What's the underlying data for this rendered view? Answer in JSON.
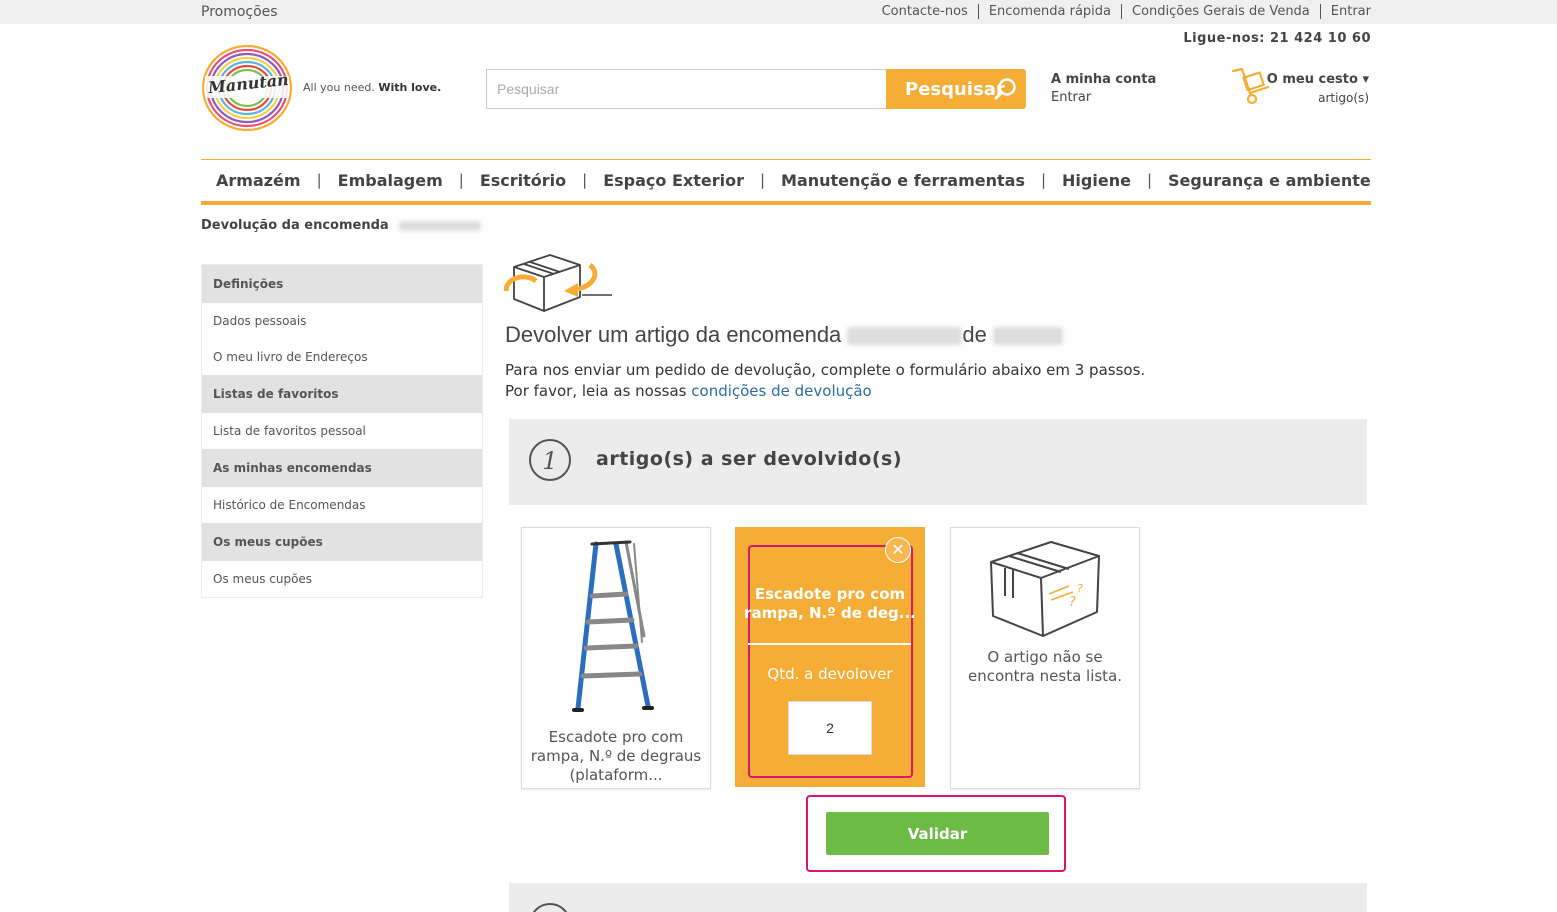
{
  "topbar": {
    "promo": "Promoções",
    "links": [
      "Contacte-nos",
      "Encomenda rápida",
      "Condições Gerais de Venda",
      "Entrar"
    ]
  },
  "phone": "Ligue-nos: 21 424 10 60",
  "brand": {
    "logo_text": "Manutan",
    "tagline_a": "All you need.",
    "tagline_b": "With love."
  },
  "search": {
    "placeholder": "Pesquisar",
    "button": "Pesquisar"
  },
  "account": {
    "title": "A minha conta",
    "sub": "Entrar"
  },
  "cart": {
    "title": "O meu cesto",
    "sub": "artigo(s)"
  },
  "nav": [
    "Armazém",
    "Embalagem",
    "Escritório",
    "Espaço Exterior",
    "Manutenção e ferramentas",
    "Higiene",
    "Segurança e ambiente"
  ],
  "breadcrumb": "Devolução da encomenda",
  "sidebar": [
    {
      "header": "Definições",
      "items": [
        "Dados pessoais",
        "O meu livro de Endereços"
      ]
    },
    {
      "header": "Listas de favoritos",
      "items": [
        "Lista de favoritos pessoal"
      ]
    },
    {
      "header": "As minhas encomendas",
      "items": [
        "Histórico de Encomendas"
      ]
    },
    {
      "header": "Os meus cupões",
      "items": [
        "Os meus cupões"
      ]
    }
  ],
  "main": {
    "heading_a": "Devolver um artigo da encomenda",
    "heading_b": "de",
    "intro_line1": "Para nos enviar um pedido de devolução, complete o formulário abaixo em 3 passos.",
    "intro_line2": "Por favor, leia as nossas",
    "intro_link": "condições de devolução",
    "step1_num": "1",
    "step1_title": "artigo(s) a ser devolvido(s)",
    "product_caption": "Escadote pro com rampa, N.º de degraus (plataform...",
    "selected_title_1": "Escadote pro com",
    "selected_title_2": "rampa, N.º de deg...",
    "qty_label": "Qtd. a devolover",
    "qty_value": "2",
    "not_in_list": "O artigo não se encontra nesta lista.",
    "validate": "Validar"
  },
  "colors": {
    "accent": "#f5ad35",
    "highlight": "#d6196e",
    "validate": "#6cbb44",
    "link": "#2b6ca8"
  }
}
